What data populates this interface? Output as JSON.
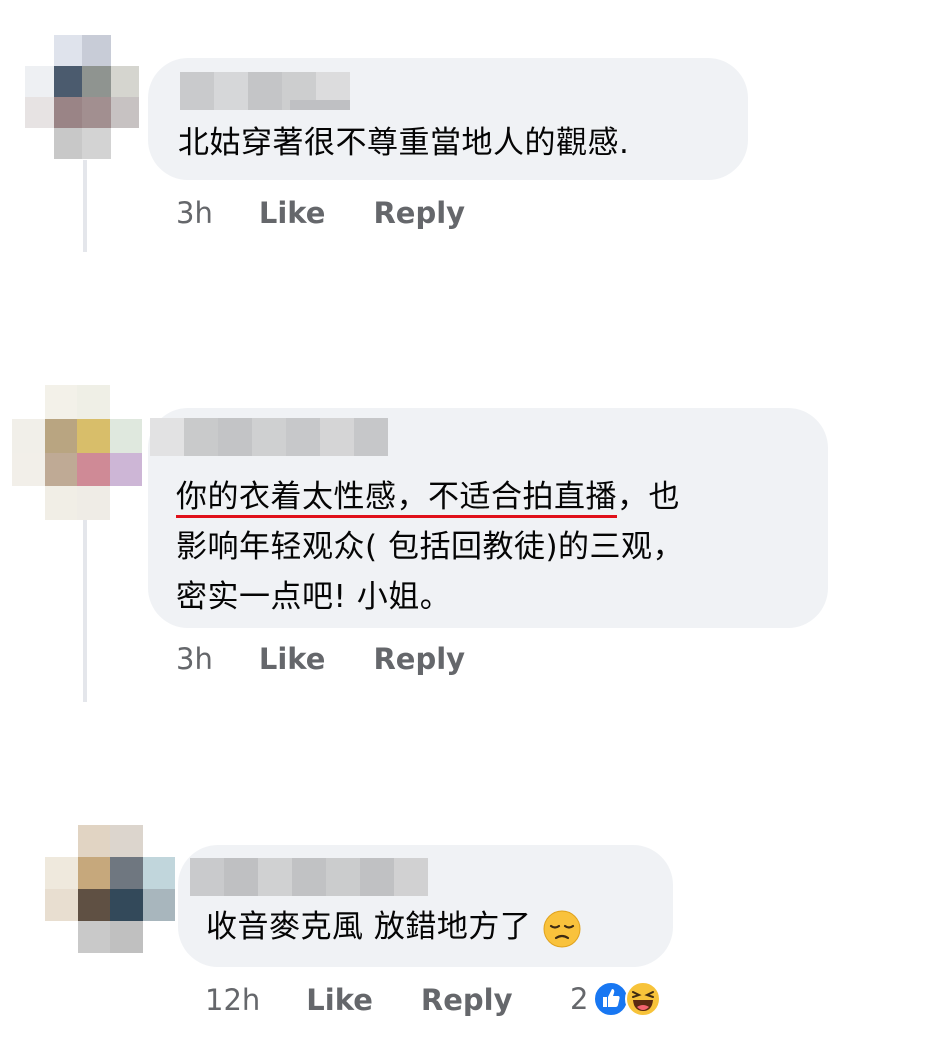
{
  "comments": [
    {
      "text_lines": [
        "北姑穿著很不尊重當地人的觀感."
      ],
      "time": "3h",
      "like_label": "Like",
      "reply_label": "Reply"
    },
    {
      "text_lines": [
        "你的衣着太性感，不适合拍直播，也",
        "影响年轻观众( 包括回教徒)的三观，",
        "密实一点吧! 小姐。"
      ],
      "underlined_text": "你的衣着太性感，不适合拍直播",
      "line1_rest": "，也",
      "time": "3h",
      "like_label": "Like",
      "reply_label": "Reply"
    },
    {
      "text": "收音麥克風 放錯地方了",
      "trailing_emoji": "disappointed-face",
      "time": "12h",
      "like_label": "Like",
      "reply_label": "Reply",
      "reaction_count": "2",
      "reactions": [
        "like-reaction",
        "haha-reaction"
      ]
    }
  ]
}
